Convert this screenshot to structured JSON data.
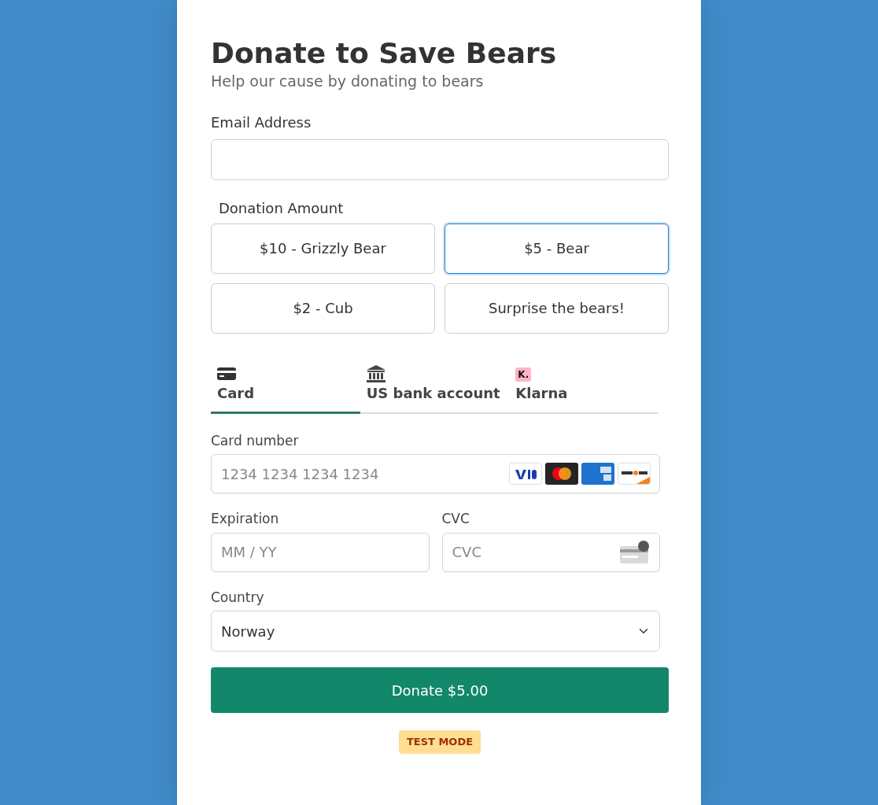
{
  "title": "Donate to Save Bears",
  "subtitle": "Help our cause by donating to bears",
  "email": {
    "label": "Email Address"
  },
  "donation": {
    "label": "Donation Amount",
    "options": [
      {
        "label": "$10 - Grizzly Bear",
        "selected": false
      },
      {
        "label": "$5 - Bear",
        "selected": true
      },
      {
        "label": "$2 - Cub",
        "selected": false
      },
      {
        "label": "Surprise the bears!",
        "selected": false
      }
    ]
  },
  "payment_tabs": [
    {
      "kind": "card",
      "label": "Card",
      "selected": true
    },
    {
      "kind": "bank",
      "label": "US bank account",
      "selected": false
    },
    {
      "kind": "klarna",
      "label": "Klarna",
      "badge": "K.",
      "selected": false
    }
  ],
  "card_number": {
    "label": "Card number",
    "placeholder": "1234 1234 1234 1234"
  },
  "expiration": {
    "label": "Expiration",
    "placeholder": "MM / YY"
  },
  "cvc": {
    "label": "CVC",
    "placeholder": "CVC"
  },
  "country": {
    "label": "Country",
    "value": "Norway"
  },
  "submit": "Donate $5.00",
  "mode_badge": "TEST MODE"
}
